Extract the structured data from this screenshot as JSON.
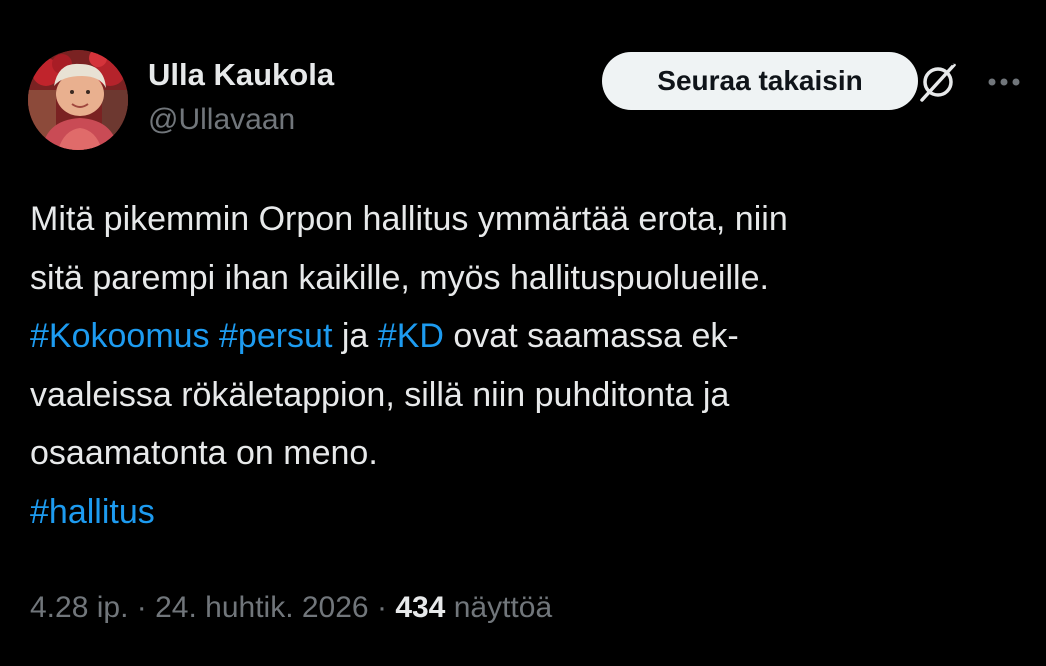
{
  "author": {
    "display_name": "Ulla Kaukola",
    "handle": "@Ullavaan"
  },
  "actions": {
    "follow_label": "Seuraa takaisin",
    "grok_icon": "grok-icon",
    "more_icon": "more-horizontal-icon"
  },
  "tweet": {
    "line1": "Mitä pikemmin Orpon hallitus ymmärtää erota, niin",
    "line2": "sitä parempi ihan kaikille, myös hallituspuolueille.",
    "line3": {
      "tag1": "#Kokoomus",
      "tag2": "#persut",
      "word_ja": "ja",
      "tag3": "#KD",
      "rest": "ovat saamassa ek-"
    },
    "line4": "vaaleissa rökäletappion, sillä niin puhditonta ja",
    "line5": "osaamatonta on meno.",
    "line6_tag": "#hallitus"
  },
  "meta": {
    "time": "4.28 ip.",
    "separator": "·",
    "date": "24. huhtik. 2026",
    "views_count": "434",
    "views_label": "näyttöä"
  },
  "colors": {
    "background": "#000000",
    "text": "#e7e9ea",
    "secondary": "#71767b",
    "link": "#1d9bf0",
    "button_bg": "#eff3f4"
  }
}
